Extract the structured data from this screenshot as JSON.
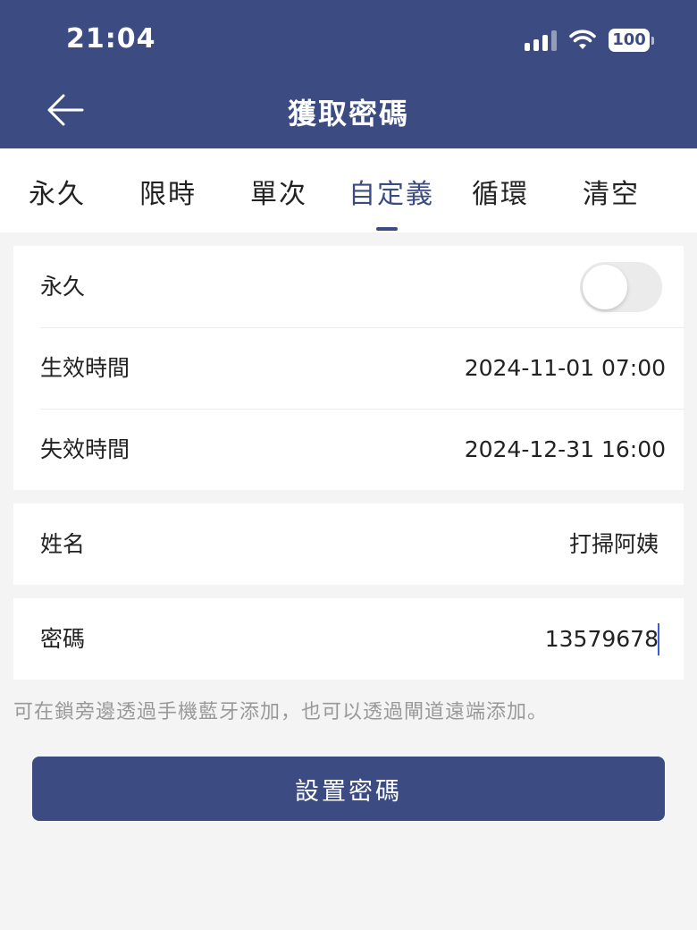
{
  "status_bar": {
    "time": "21:04",
    "battery": "100",
    "icons": [
      "cellular-signal-icon",
      "wifi-icon",
      "battery-icon"
    ]
  },
  "header": {
    "title": "獲取密碼",
    "back_icon": "back-arrow-icon"
  },
  "tabs": [
    {
      "label": "永久",
      "active": false
    },
    {
      "label": "限時",
      "active": false
    },
    {
      "label": "單次",
      "active": false
    },
    {
      "label": "自定義",
      "active": true
    },
    {
      "label": "循環",
      "active": false
    },
    {
      "label": "清空",
      "active": false
    }
  ],
  "validity": {
    "permanent_label": "永久",
    "permanent_enabled": false,
    "start_label": "生效時間",
    "start_value": "2024-11-01 07:00",
    "end_label": "失效時間",
    "end_value": "2024-12-31 16:00"
  },
  "name": {
    "label": "姓名",
    "value": "打掃阿姨"
  },
  "password": {
    "label": "密碼",
    "value": "13579678"
  },
  "hint": "可在鎖旁邊透過手機藍牙添加，也可以透過閘道遠端添加。",
  "submit_label": "設置密碼",
  "colors": {
    "primary": "#3c4c82",
    "background": "#f4f4f4",
    "hint_text": "#999999",
    "caret": "#3c5bd6"
  }
}
